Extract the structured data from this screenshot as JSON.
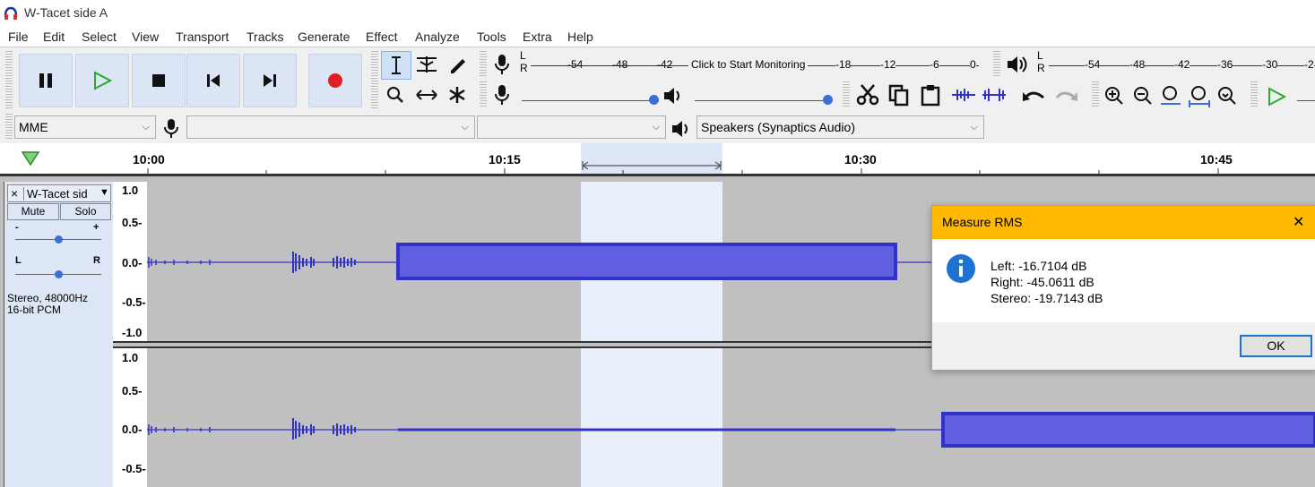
{
  "window": {
    "title": "W-Tacet side A"
  },
  "menu": [
    "File",
    "Edit",
    "Select",
    "View",
    "Transport",
    "Tracks",
    "Generate",
    "Effect",
    "Analyze",
    "Tools",
    "Extra",
    "Help"
  ],
  "transport": {
    "pause_icon": "pause-icon",
    "play_icon": "play-icon",
    "stop_icon": "stop-icon",
    "skip_start_icon": "skip-to-start-icon",
    "skip_end_icon": "skip-to-end-icon",
    "record_icon": "record-icon"
  },
  "meters": {
    "record_scale": [
      "-54",
      "-48",
      "-42",
      "-18",
      "-12",
      "-6",
      "0"
    ],
    "monitor_prompt": "Click to Start Monitoring",
    "playback_scale": [
      "-54",
      "-48",
      "-42",
      "-36",
      "-30",
      "-2"
    ],
    "channel_l": "L",
    "channel_r": "R"
  },
  "device": {
    "host": "MME",
    "recording_device": "",
    "recording_channels": "",
    "playback_device": "Speakers (Synaptics Audio)"
  },
  "timeline": {
    "labels": [
      "10:00",
      "10:15",
      "10:30",
      "10:45"
    ]
  },
  "track": {
    "name": "W-Tacet sid",
    "close": "×",
    "mute": "Mute",
    "solo": "Solo",
    "gain_minus": "-",
    "gain_plus": "+",
    "pan_l": "L",
    "pan_r": "R",
    "info_line1": "Stereo, 48000Hz",
    "info_line2": "16-bit PCM",
    "scale_top": [
      "1.0",
      "0.5-",
      "0.0-",
      "-0.5-",
      "-1.0"
    ],
    "scale_bottom": [
      "1.0",
      "0.5-",
      "0.0-",
      "-0.5-"
    ]
  },
  "dialog": {
    "title": "Measure RMS",
    "left": "Left: -16.7104 dB",
    "right": "Right: -45.0611 dB",
    "stereo": "Stereo: -19.7143 dB",
    "ok": "OK",
    "close": "✕"
  },
  "colors": {
    "waveform": "#3232c8",
    "waveform_fill": "#6060e0",
    "selection": "#e9f0fb",
    "dialog_title": "#ffb900",
    "record": "#e02020",
    "play": "#2ea82e"
  }
}
